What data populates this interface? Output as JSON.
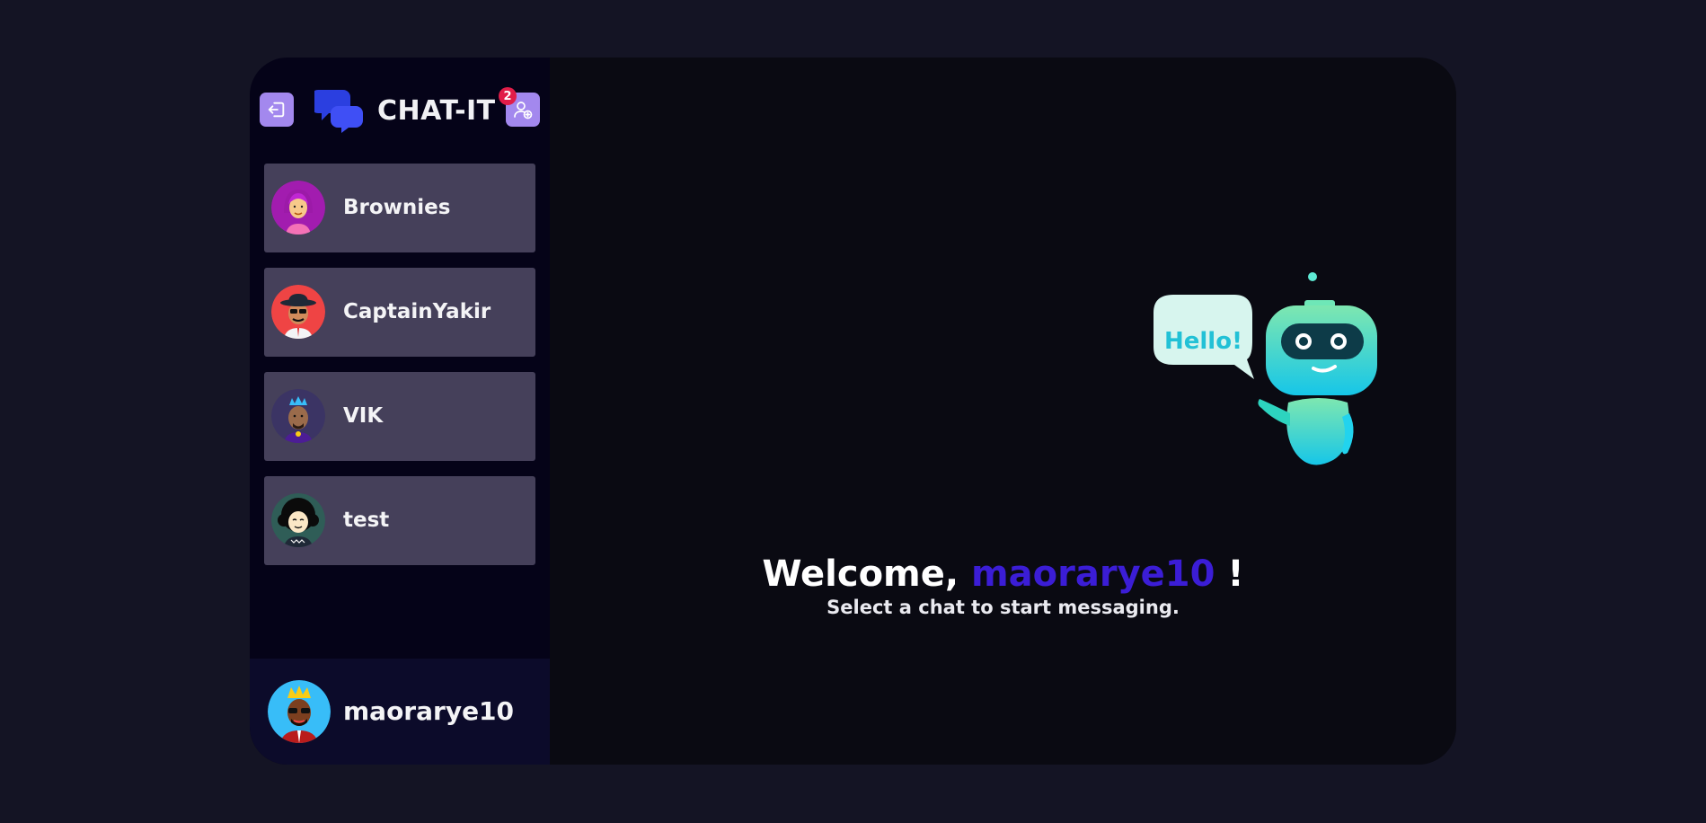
{
  "app": {
    "title": "CHAT-IT",
    "notification_count": "2"
  },
  "sidebar": {
    "logout_icon": "logout-icon",
    "add_friend_icon": "user-plus-icon",
    "chats": [
      {
        "name": "Brownies",
        "avatar": "woman-avatar"
      },
      {
        "name": "CaptainYakir",
        "avatar": "man-sunglasses-hat-avatar"
      },
      {
        "name": "VIK",
        "avatar": "man-blue-hair-avatar"
      },
      {
        "name": "test",
        "avatar": "curly-hair-avatar"
      }
    ],
    "current_user": {
      "name": "maorarye10",
      "avatar": "king-avatar"
    }
  },
  "main": {
    "greeting_prefix": "Welcome,",
    "username": "maorarye10",
    "greeting_suffix": "!",
    "subtitle": "Select a chat to start messaging.",
    "robot_bubble": "Hello!"
  },
  "colors": {
    "accent": "#3b1dd6",
    "button": "#a388ee",
    "chat_item_bg": "#45405a",
    "badge": "#e11d48"
  }
}
